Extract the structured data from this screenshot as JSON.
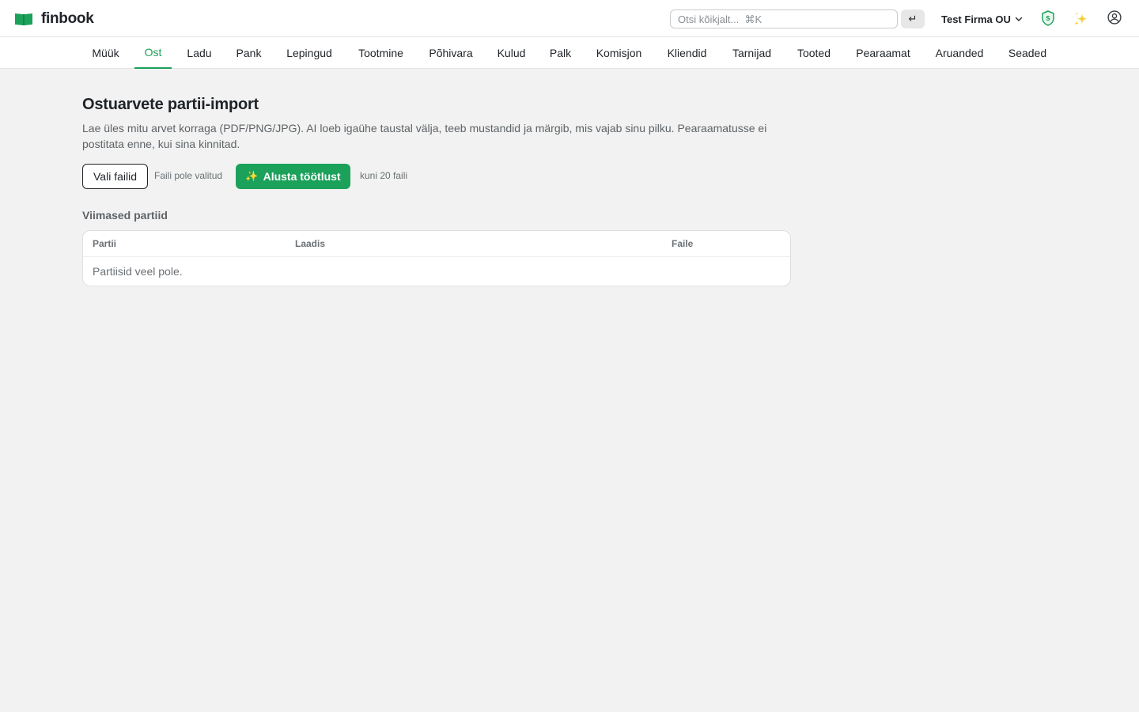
{
  "app": {
    "name": "finbook",
    "brand_color": "#1ca15a"
  },
  "topbar": {
    "search_placeholder": "Otsi kõikjalt...  ⌘K",
    "enter_glyph": "↵",
    "company_name": "Test Firma OU",
    "icons": [
      "logo-book-icon",
      "shield-s-icon",
      "sparkle-icon",
      "user-circle-icon",
      "chevron-down-icon"
    ]
  },
  "nav": {
    "active": "Ost",
    "items": [
      {
        "label": "Müük"
      },
      {
        "label": "Ost"
      },
      {
        "label": "Ladu"
      },
      {
        "label": "Pank"
      },
      {
        "label": "Lepingud"
      },
      {
        "label": "Tootmine"
      },
      {
        "label": "Põhivara"
      },
      {
        "label": "Kulud"
      },
      {
        "label": "Palk"
      },
      {
        "label": "Komisjon"
      },
      {
        "label": "Kliendid"
      },
      {
        "label": "Tarnijad"
      },
      {
        "label": "Tooted"
      },
      {
        "label": "Pearaamat"
      },
      {
        "label": "Aruanded"
      },
      {
        "label": "Seaded"
      }
    ]
  },
  "main": {
    "title": "Ostuarvete partii-import",
    "description": "Lae üles mitu arvet korraga (PDF/PNG/JPG). AI loeb igaühe taustal välja, teeb mustandid ja märgib, mis vajab sinu pilku. Pearaamatusse ei postitata enne, kui sina kinnitad.",
    "choose_files_label": "Vali failid",
    "no_file_label": "Faili pole valitud",
    "start_icon": "✨",
    "start_label": "Alusta töötlust",
    "limit_label": "kuni 20 faili",
    "recent_title": "Viimased partiid",
    "table": {
      "columns": [
        "Partii",
        "Laadis",
        "Faile"
      ],
      "empty_text": "Partiisid veel pole."
    }
  }
}
